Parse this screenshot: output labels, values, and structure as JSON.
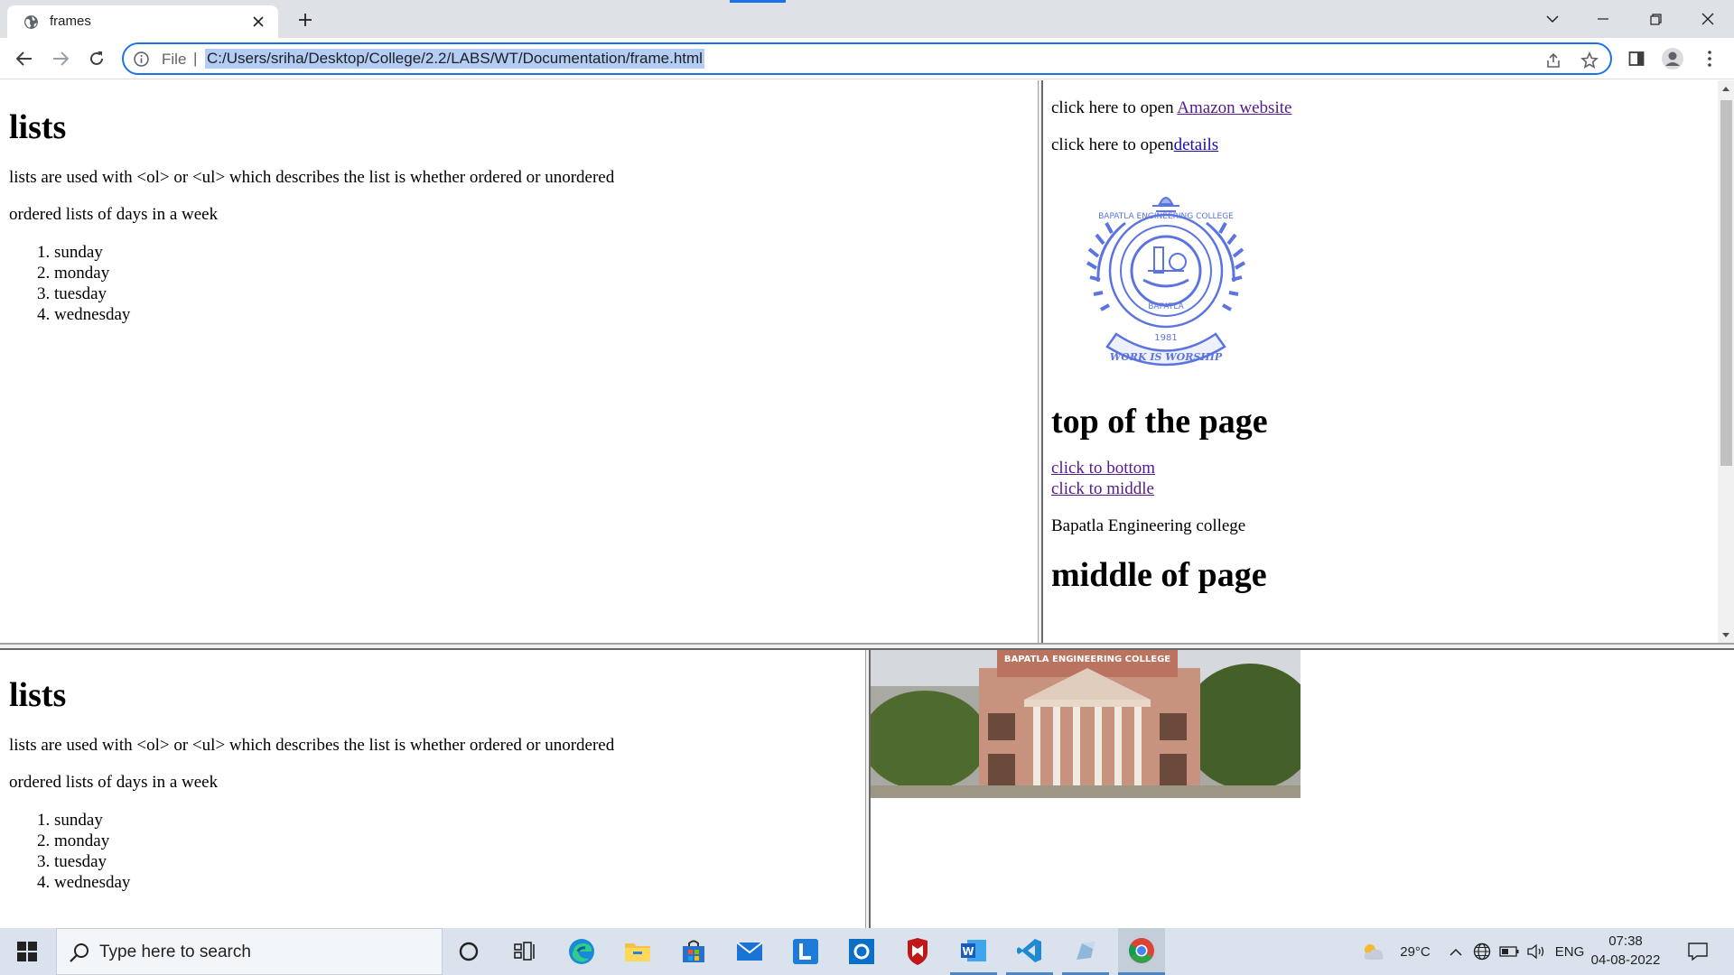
{
  "browser": {
    "tab_title": "frames",
    "omnibox_scheme": "File",
    "omnibox_separator": "|",
    "url": "C:/Users/sriha/Desktop/College/2.2/LABS/WT/Documentation/frame.html",
    "accent_color": "#1a73e8"
  },
  "frame_top_left": {
    "heading": "lists",
    "intro": "lists are used with <ol> or <ul> which describes the list is whether ordered or unordered",
    "subheading": "ordered lists of days in a week",
    "days": [
      "sunday",
      "monday",
      "tuesday",
      "wednesday"
    ]
  },
  "frame_top_right": {
    "amazon_prefix": "click here to open ",
    "amazon_link": "Amazon website",
    "details_prefix": "click here to open",
    "details_link": "details",
    "logo": {
      "icon": "college-seal",
      "ring_text": "BAPATLA ENGINEERING COLLEGE",
      "inner_text": "BAPATLA",
      "year": "1981",
      "motto": "WORK IS WORSHIP"
    },
    "top_heading": "top of the page",
    "link_bottom": "click to bottom",
    "link_middle": "click to middle",
    "college_name": "Bapatla Engineering college",
    "middle_heading": "middle of page"
  },
  "frame_bottom_left": {
    "heading": "lists",
    "intro": "lists are used with <ol> or <ul> which describes the list is whether ordered or unordered",
    "subheading": "ordered lists of days in a week",
    "days": [
      "sunday",
      "monday",
      "tuesday",
      "wednesday"
    ]
  },
  "frame_bottom_right": {
    "photo_banner": "BAPATLA ENGINEERING COLLEGE"
  },
  "taskbar": {
    "search_placeholder": "Type here to search",
    "weather_temp": "29°C",
    "language": "ENG",
    "time": "07:38",
    "date": "04-08-2022",
    "apps": [
      "cortana-icon",
      "task-view-icon",
      "edge-icon",
      "file-explorer-icon",
      "store-icon",
      "mail-icon",
      "l-app-icon",
      "outlook-icon",
      "mcafee-icon",
      "word-icon",
      "vscode-icon",
      "app-icon",
      "chrome-icon"
    ]
  }
}
